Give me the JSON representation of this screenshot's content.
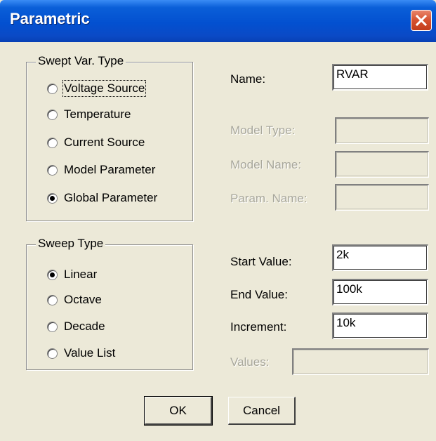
{
  "window": {
    "title": "Parametric"
  },
  "swept_var": {
    "legend": "Swept Var. Type",
    "options": [
      {
        "label": "Voltage Source",
        "selected": false
      },
      {
        "label": "Temperature",
        "selected": false
      },
      {
        "label": "Current Source",
        "selected": false
      },
      {
        "label": "Model Parameter",
        "selected": false
      },
      {
        "label": "Global Parameter",
        "selected": true
      }
    ]
  },
  "sweep_type": {
    "legend": "Sweep Type",
    "options": [
      {
        "label": "Linear",
        "selected": true
      },
      {
        "label": "Octave",
        "selected": false
      },
      {
        "label": "Decade",
        "selected": false
      },
      {
        "label": "Value List",
        "selected": false
      }
    ]
  },
  "fields": {
    "name": {
      "label": "Name:",
      "value": "RVAR"
    },
    "model_type": {
      "label": "Model Type:",
      "value": ""
    },
    "model_name": {
      "label": "Model Name:",
      "value": ""
    },
    "param_name": {
      "label": "Param. Name:",
      "value": ""
    },
    "start_value": {
      "label": "Start Value:",
      "value": "2k"
    },
    "end_value": {
      "label": "End Value:",
      "value": "100k"
    },
    "increment": {
      "label": "Increment:",
      "value": "10k"
    },
    "values": {
      "label": "Values:",
      "value": ""
    }
  },
  "buttons": {
    "ok": "OK",
    "cancel": "Cancel"
  },
  "colors": {
    "title_bar": "#0350d0",
    "close_button": "#d5512f",
    "dialog_bg": "#ece9d8",
    "disabled_text": "#a8a79b"
  },
  "icons": {
    "close": "close-icon"
  }
}
